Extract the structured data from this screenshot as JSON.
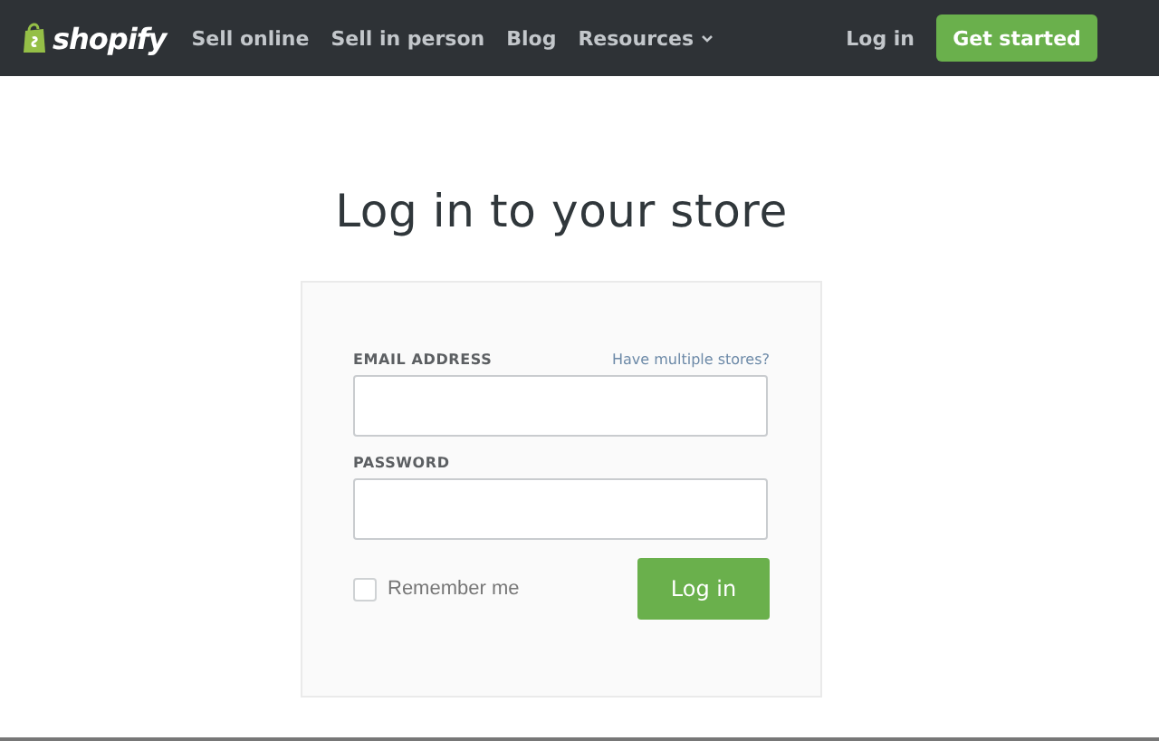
{
  "header": {
    "logo": "shopify",
    "nav": [
      {
        "label": "Sell online",
        "dropdown": false
      },
      {
        "label": "Sell in person",
        "dropdown": false
      },
      {
        "label": "Blog",
        "dropdown": false
      },
      {
        "label": "Resources",
        "dropdown": true
      }
    ],
    "login_link": "Log in",
    "cta_button": "Get started"
  },
  "title": "Log in to your store",
  "form": {
    "email_label": "EMAIL ADDRESS",
    "multiple_stores_link": "Have multiple stores?",
    "password_label": "PASSWORD",
    "remember": {
      "label": "Remember me",
      "checked": false
    },
    "submit_button": "Log in"
  }
}
